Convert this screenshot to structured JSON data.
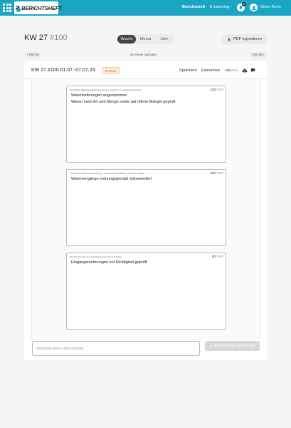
{
  "header": {
    "brand": "BERICHTSHEFT",
    "nav_berichtsheft": "Berichtsheft",
    "nav_elearning": "E-Learning",
    "notification_count": "10",
    "user_name": "Oliver Kuhn"
  },
  "page": {
    "title_week": "KW 27",
    "title_number": "#100",
    "views": [
      "Woche",
      "Monat",
      "Jahr"
    ],
    "active_view": "Woche",
    "export_label": "PDF exportieren",
    "prev_week": "‹ KW 26",
    "today": "Zu Heute springen",
    "next_week": "KW 28 ›"
  },
  "report": {
    "title": "KW 27 #100 01.07.-07.07.24",
    "status": "Entwurf",
    "save_label": "Speichern",
    "submit_label": "Einreichen",
    "chars_used": "495",
    "chars_max": "/3000",
    "sections": [
      {
        "label": "Betriebliche Tätigkeiten (Praktische Arbeiten, Ausführen von Arbeitsanweisungen)",
        "count": "223",
        "max": "/1000",
        "content": "Warenlieferungen angenommen\nWaren nach Art und Menge sowie auf offene Mängel geprüft"
      },
      {
        "label": "Themen der Woche (Unterweisungen, Schulungen, betrieblicher Unterricht, Projekte)",
        "count": "222",
        "max": "/1000",
        "content": "Wareneingänge ordnungsgemäß dokumentiert"
      },
      {
        "label": "Berufsschule (Themen und Schwerpunkte des Unterrichts)",
        "count": "50",
        "max": "/1000",
        "content": "Eingangsrechnungen auf Richtigkeit geprüft"
      }
    ]
  },
  "comment": {
    "placeholder": "Schreibe einen Kommentar",
    "submit_label": "Kommentar abschicken"
  },
  "colors": {
    "topbar": "#1aa5c2",
    "draft": "#c97b1a"
  }
}
